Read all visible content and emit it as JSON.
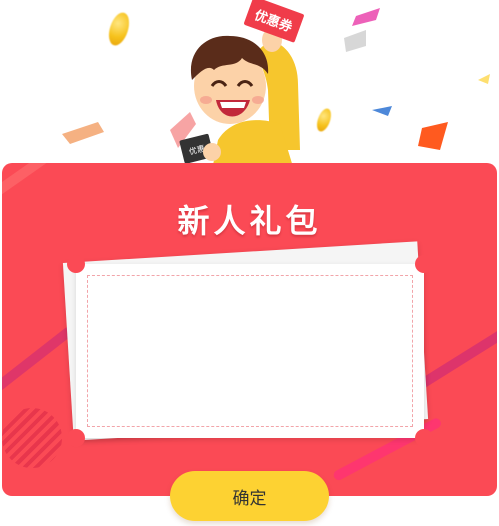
{
  "dialog": {
    "title": "新人礼包",
    "confirm_label": "确定"
  },
  "illustration": {
    "coupon_text": "优惠券",
    "ticket_text": "优惠"
  },
  "colors": {
    "card_red": "#fb4a55",
    "button_yellow": "#fdd232",
    "button_text": "#333333",
    "title_white": "#ffffff"
  }
}
